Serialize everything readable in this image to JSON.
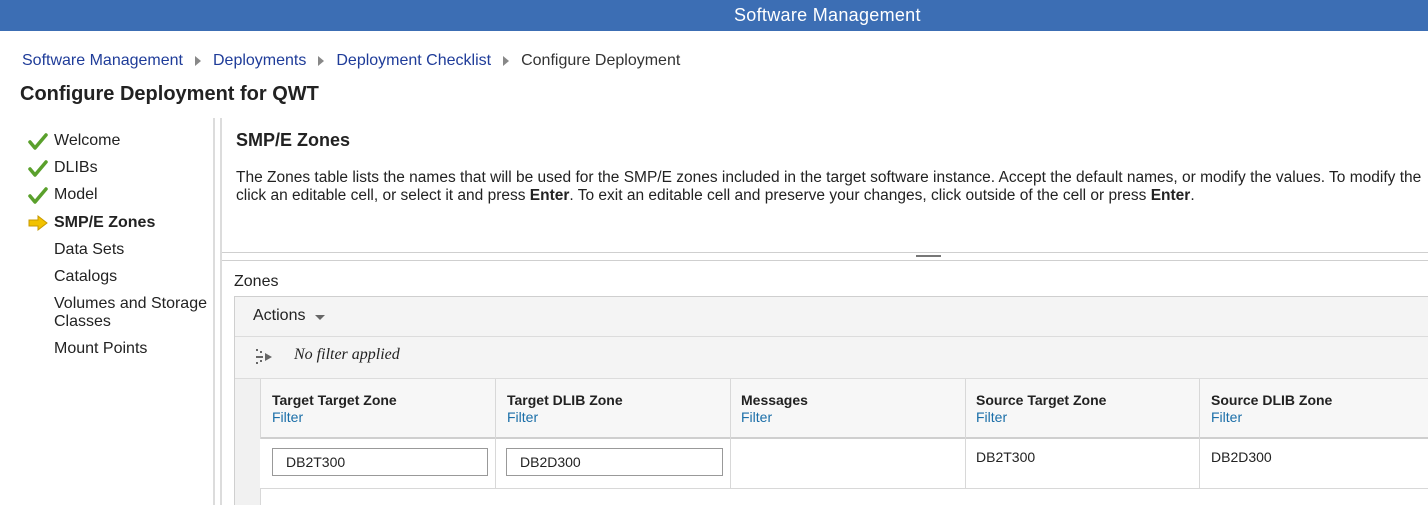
{
  "app": {
    "title": "Software Management"
  },
  "breadcrumb": {
    "items": [
      "Software Management",
      "Deployments",
      "Deployment Checklist"
    ],
    "current": "Configure Deployment"
  },
  "page": {
    "title": "Configure Deployment for QWT"
  },
  "sidebar": {
    "items": [
      {
        "label": "Welcome",
        "state": "done",
        "icon": "checkmark-icon"
      },
      {
        "label": "DLIBs",
        "state": "done",
        "icon": "checkmark-icon"
      },
      {
        "label": "Model",
        "state": "done",
        "icon": "checkmark-icon"
      },
      {
        "label": "SMP/E Zones",
        "state": "current",
        "icon": "arrow-right-icon"
      },
      {
        "label": "Data Sets",
        "state": "todo"
      },
      {
        "label": "Catalogs",
        "state": "todo"
      },
      {
        "label": "Volumes and Storage Classes",
        "state": "todo"
      },
      {
        "label": "Mount Points",
        "state": "todo"
      }
    ]
  },
  "section": {
    "title": "SMP/E Zones",
    "desc_line1": "The Zones table lists the names that will be used for the SMP/E zones included in the target software instance.  Accept the default names, or modify the values. To modify the",
    "desc_line2_a": "click an editable cell, or select it and press ",
    "desc_line2_b": "Enter",
    "desc_line2_c": ".  To exit an editable cell and preserve your changes, click outside of the cell or press ",
    "desc_line2_d": "Enter",
    "desc_line2_e": "."
  },
  "zones": {
    "label": "Zones",
    "actions_label": "Actions",
    "filter_status": "No filter applied",
    "columns": [
      {
        "header": "Target Target Zone",
        "filter": "Filter"
      },
      {
        "header": "Target DLIB Zone",
        "filter": "Filter"
      },
      {
        "header": "Messages",
        "filter": "Filter"
      },
      {
        "header": "Source Target Zone",
        "filter": "Filter"
      },
      {
        "header": "Source DLIB Zone",
        "filter": "Filter"
      }
    ],
    "rows": [
      {
        "target_target_zone": "DB2T300",
        "target_dlib_zone": "DB2D300",
        "messages": "",
        "source_target_zone": "DB2T300",
        "source_dlib_zone": "DB2D300"
      }
    ]
  },
  "colors": {
    "header_bar": "#3c6eb4",
    "link": "#1f3c99",
    "filter_link": "#1a6ea8",
    "check": "#5aa02c",
    "arrow": "#f2c200"
  }
}
